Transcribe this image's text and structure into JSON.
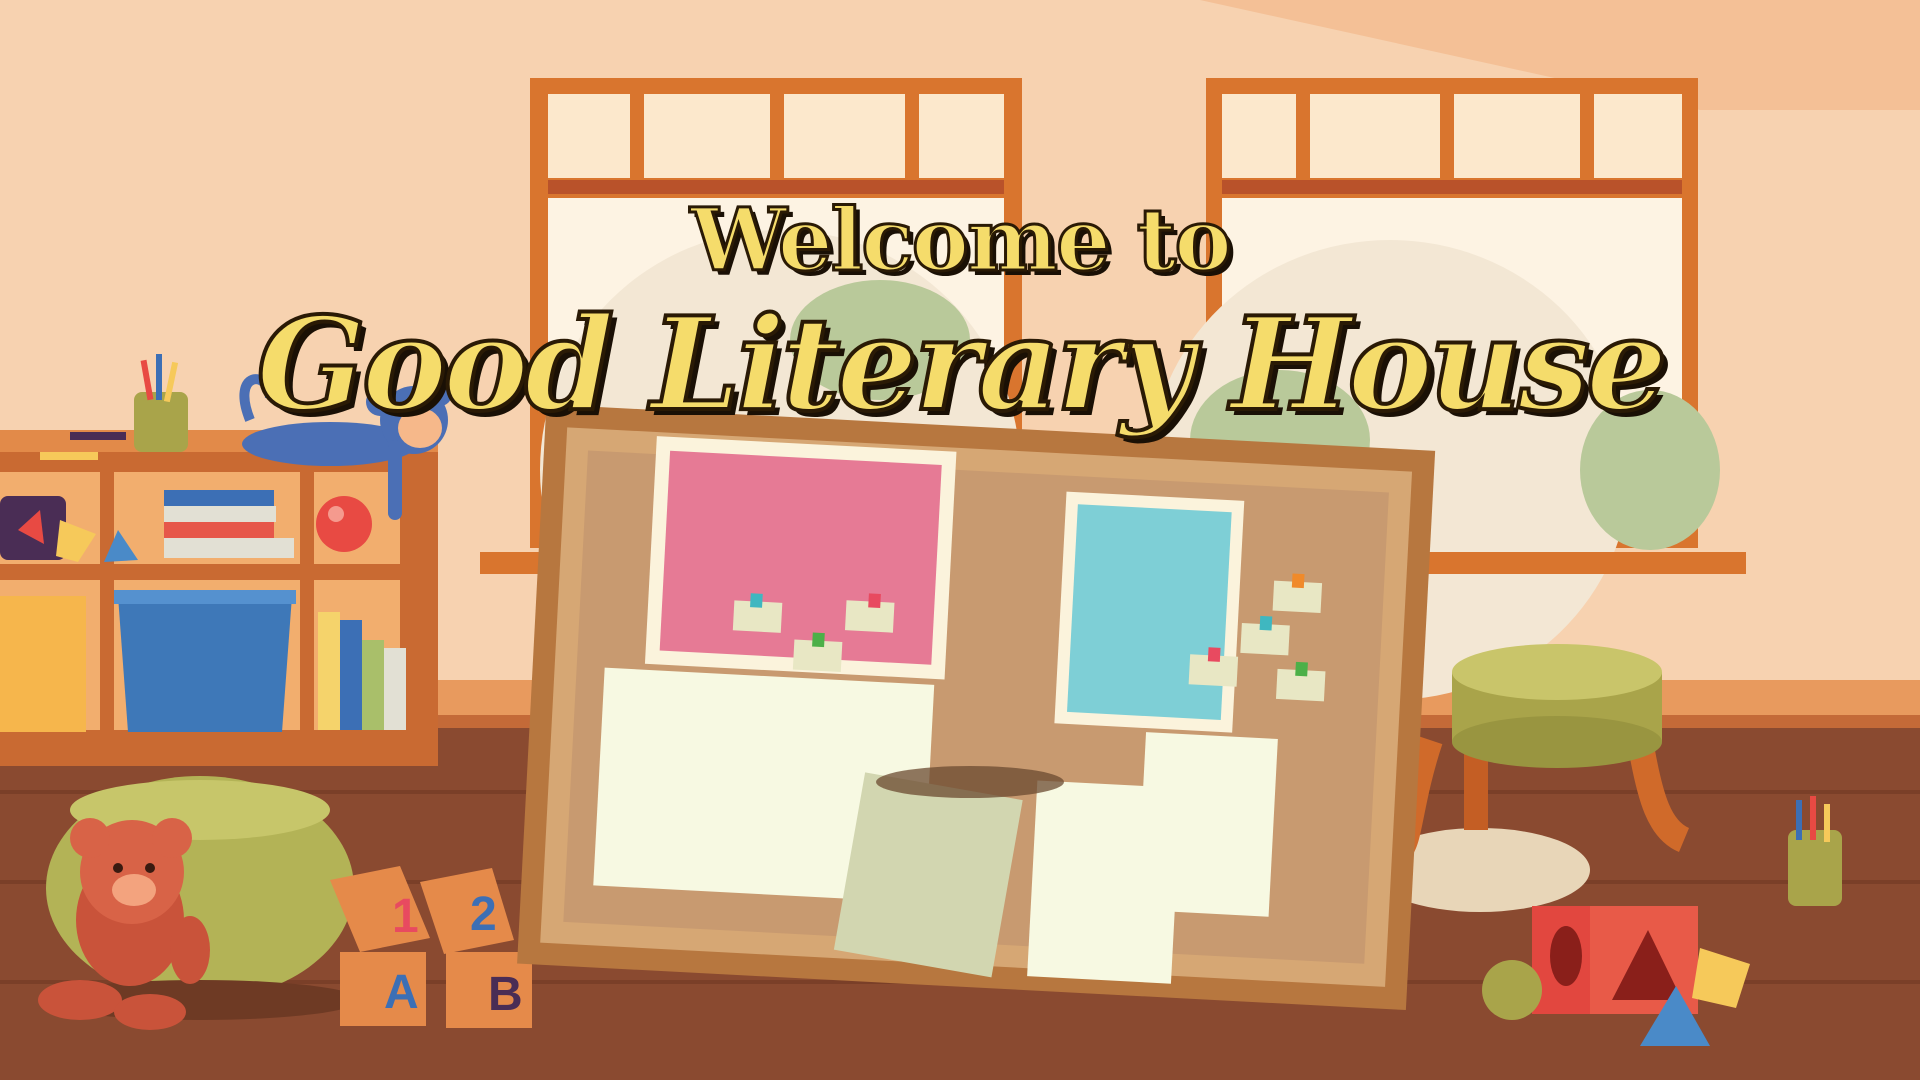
{
  "title": {
    "line1": "Welcome  to",
    "line2": "Good Literary House"
  },
  "blocks": {
    "block1": "1",
    "block2": "2",
    "blockA": "A",
    "blockB": "B"
  },
  "colors": {
    "wall": "#f7d2b0",
    "floor": "#8a4a30",
    "window_frame": "#d9752e",
    "cork": "#c89a70",
    "board_frame": "#b7773f",
    "title_fill": "#f5dc6b",
    "pink_paper": "#e67a95",
    "blue_paper": "#7ecfd6"
  }
}
